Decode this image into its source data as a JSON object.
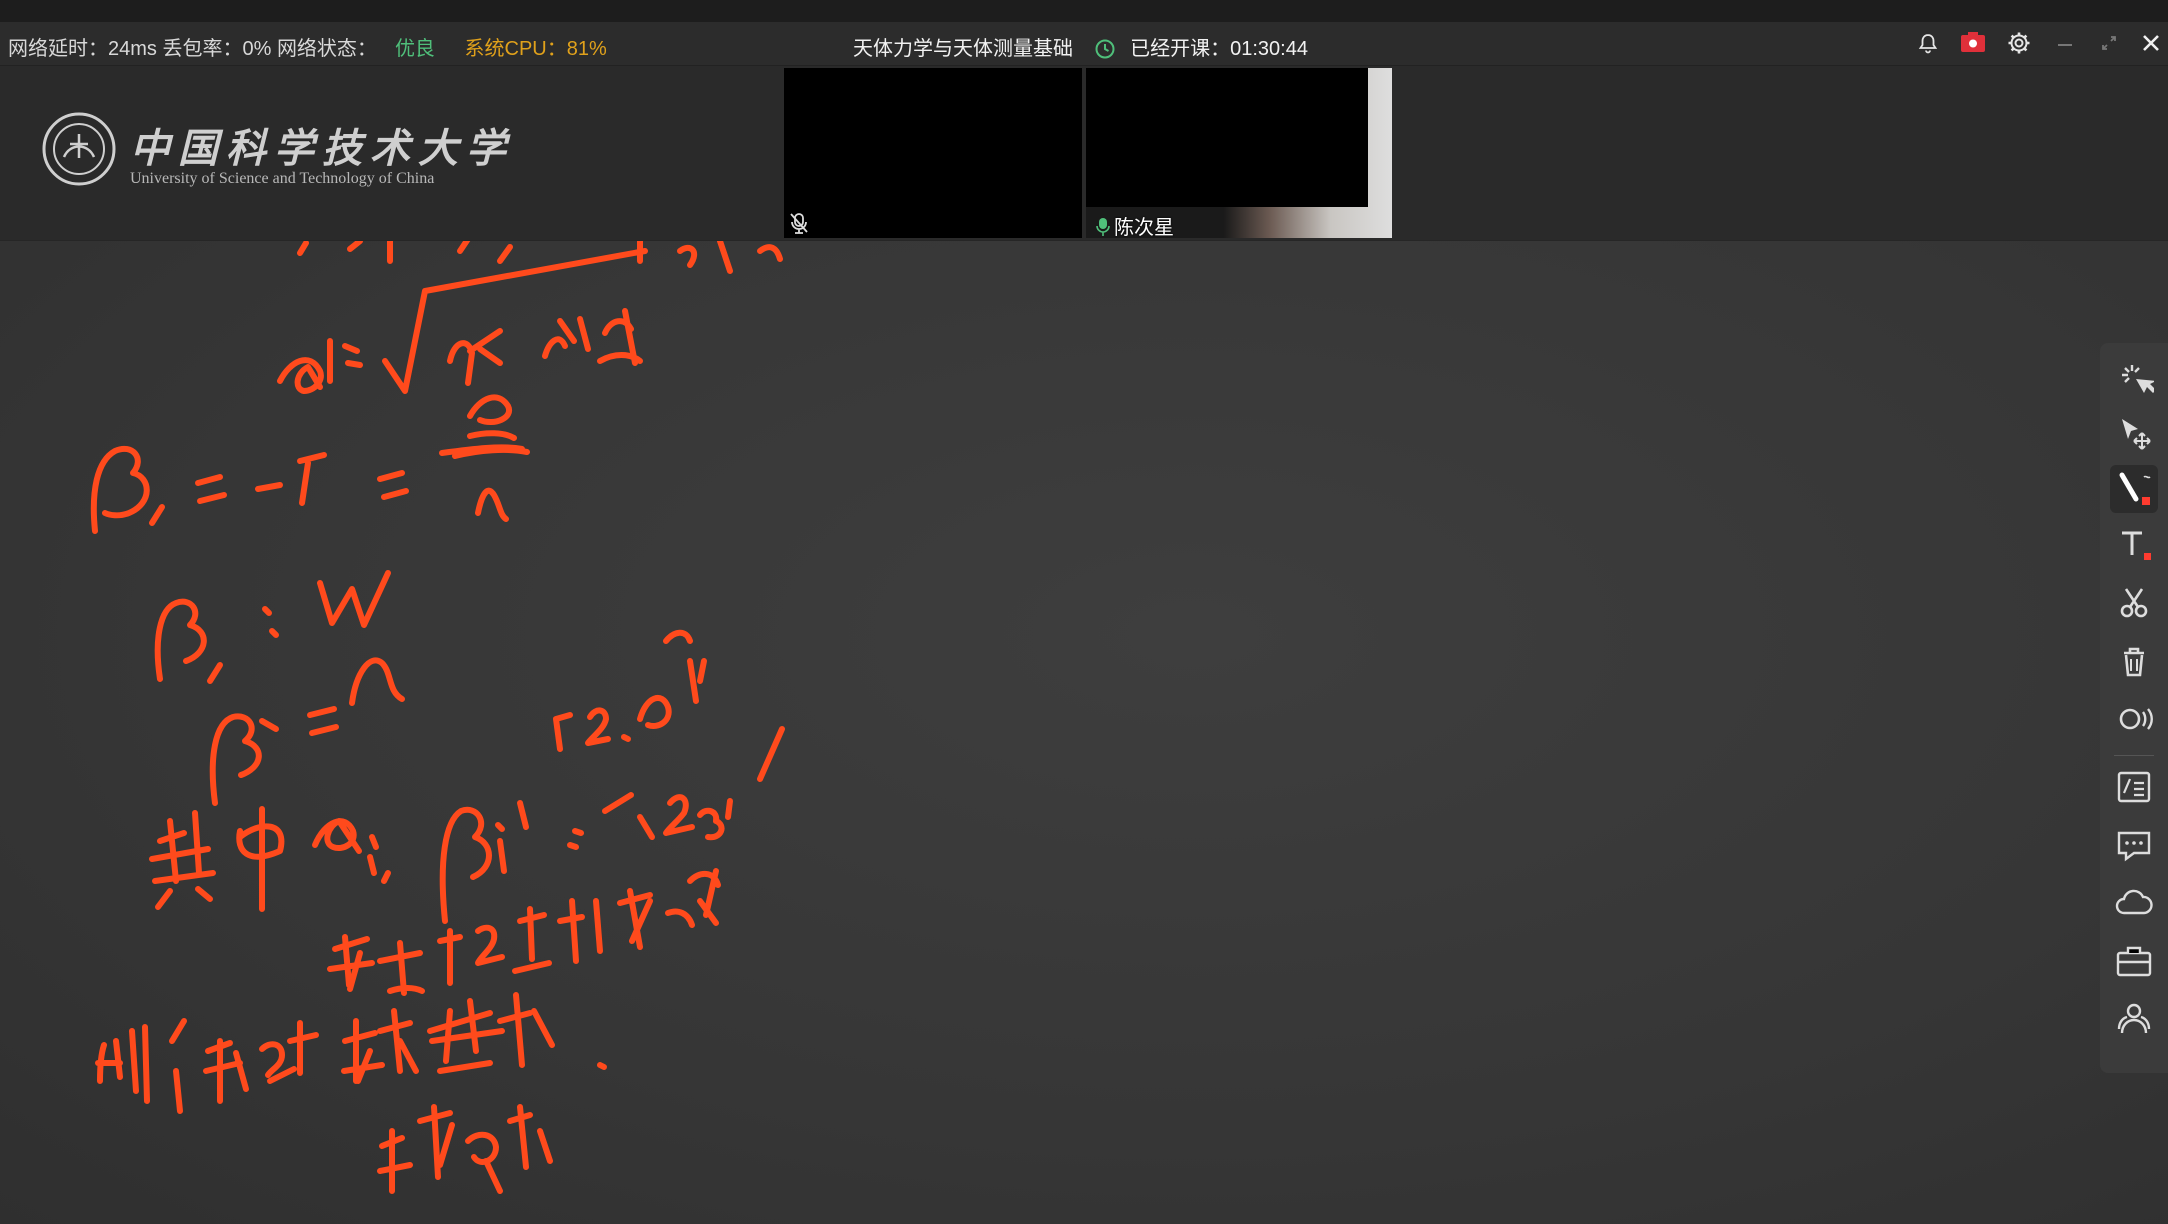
{
  "status": {
    "latency_label": "网络延时：",
    "latency_value": "24ms",
    "loss_label": "丢包率：",
    "loss_value": "0%",
    "net_label": "网络状态：",
    "net_value": "优良",
    "cpu_label": "系统CPU：",
    "cpu_value": "81%"
  },
  "course": {
    "title": "天体力学与天体测量基础",
    "elapsed_label": "已经开课：",
    "elapsed_value": "01:30:44"
  },
  "logo": {
    "cn": "中国科学技术大学",
    "en": "University of Science and Technology of China"
  },
  "video": {
    "participant_name": "陈次星"
  },
  "colors": {
    "ink": "#ff4a1c",
    "good": "#4fbf7a",
    "cpu": "#e0a11b",
    "board": "#3a3a3a"
  },
  "toolbar": {
    "tools": [
      "laser-pointer",
      "select-move",
      "pen",
      "text",
      "cut",
      "delete",
      "audio",
      "formula",
      "chat",
      "cloud",
      "toolbox",
      "members"
    ]
  }
}
